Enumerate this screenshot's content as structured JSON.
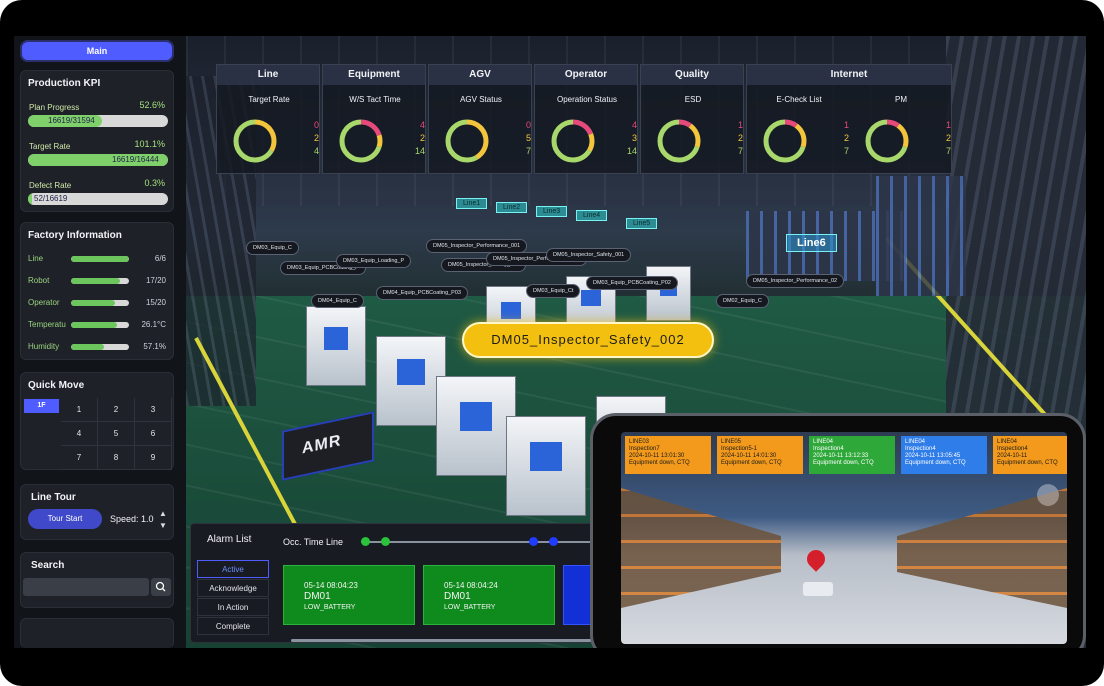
{
  "sidebar": {
    "main_label": "Main",
    "production_kpi": {
      "title": "Production KPI",
      "items": [
        {
          "label": "Plan Progress",
          "pct": "52.6%",
          "value": "16619/31594",
          "fraction": 0.526
        },
        {
          "label": "Target Rate",
          "pct": "101.1%",
          "value": "16619/16444",
          "fraction": 1.0
        },
        {
          "label": "Defect Rate",
          "pct": "0.3%",
          "value": "52/16619",
          "fraction": 0.03
        }
      ]
    },
    "factory_info": {
      "title": "Factory Information",
      "items": [
        {
          "label": "Line",
          "value": "6/6",
          "fraction": 1.0
        },
        {
          "label": "Robot",
          "value": "17/20",
          "fraction": 0.85
        },
        {
          "label": "Operator",
          "value": "15/20",
          "fraction": 0.75
        },
        {
          "label": "Temperatu",
          "value": "26.1°C",
          "fraction": 0.8
        },
        {
          "label": "Humidity",
          "value": "57.1%",
          "fraction": 0.57
        }
      ]
    },
    "quick_move": {
      "title": "Quick Move",
      "floor": "1F",
      "cells": [
        "1",
        "2",
        "3",
        "4",
        "5",
        "6",
        "7",
        "8",
        "9"
      ]
    },
    "line_tour": {
      "title": "Line Tour",
      "start_label": "Tour Start",
      "speed_label": "Speed: 1.0",
      "up": "▲",
      "down": "▼"
    },
    "search": {
      "title": "Search",
      "placeholder": "",
      "icon": "search-icon"
    }
  },
  "kpi_groups": [
    {
      "title": "Line",
      "cards": [
        {
          "title": "Target Rate",
          "counts": [
            "0",
            "2",
            "4"
          ],
          "split": [
            0,
            2,
            4
          ]
        }
      ]
    },
    {
      "title": "Equipment",
      "cards": [
        {
          "title": "W/S Tact Time",
          "counts": [
            "4",
            "2",
            "14"
          ],
          "split": [
            4,
            2,
            14
          ]
        }
      ]
    },
    {
      "title": "AGV",
      "cards": [
        {
          "title": "AGV Status",
          "counts": [
            "0",
            "5",
            "7"
          ],
          "split": [
            0,
            5,
            7
          ]
        }
      ]
    },
    {
      "title": "Operator",
      "cards": [
        {
          "title": "Operation Status",
          "counts": [
            "4",
            "3",
            "14"
          ],
          "split": [
            4,
            3,
            14
          ]
        }
      ]
    },
    {
      "title": "Quality",
      "cards": [
        {
          "title": "ESD",
          "counts": [
            "1",
            "2",
            "7"
          ],
          "split": [
            1,
            2,
            7
          ]
        }
      ]
    },
    {
      "title": "Internet",
      "cards": [
        {
          "title": "E-Check List",
          "counts": [
            "1",
            "2",
            "7"
          ],
          "split": [
            1,
            2,
            7
          ]
        },
        {
          "title": "PM",
          "counts": [
            "1",
            "2",
            "7"
          ],
          "split": [
            1,
            2,
            7
          ]
        }
      ]
    }
  ],
  "scene": {
    "highlight_label": "DM05_Inspector_Safety_002",
    "amr_label": "AMR",
    "line_tags": [
      "Line1",
      "Line2",
      "Line3",
      "Line4",
      "Line5",
      "Line6"
    ],
    "equipment_tags": [
      "DM03_Equip_C",
      "DM03_Equip_PCBCoating_P",
      "DM03_Equip_Loading_P",
      "DM04_Equip_C",
      "DM04_Equip_PCBCoating_P03",
      "DM05_Inspector_Safety_003",
      "DM05_Inspector_Performance_002",
      "DM05_Inspector_Performance_001",
      "DM05_Inspector_Safety_001",
      "DM03_Equip_PCBCoating_P02",
      "DM02_Equip_C",
      "DM05_Inspector_Performance_02",
      "DM03_Equip_Ct"
    ]
  },
  "alarm_list": {
    "title": "Alarm List",
    "tabs": [
      "Active",
      "Acknowledge",
      "In Action",
      "Complete"
    ],
    "active_tab": "Active",
    "timeline_label": "Occ. Time Line",
    "alarms": [
      {
        "time": "05-14 08:04:23",
        "device": "DM01",
        "message": "LOW_BATTERY"
      },
      {
        "time": "05-14 08:04:24",
        "device": "DM01",
        "message": "LOW_BATTERY"
      }
    ]
  },
  "phone": {
    "notifications": [
      {
        "line": "LINE03",
        "detail": "Inspection7",
        "time": "2024-10-11 13:01:30",
        "msg": "Equipment down, CTQ",
        "color": "orange"
      },
      {
        "line": "LINE05",
        "detail": "Inspection5-1",
        "time": "2024-10-11 14:01:30",
        "msg": "Equipment down, CTQ",
        "color": "orange"
      },
      {
        "line": "LINE04",
        "detail": "Inspection4",
        "time": "2024-10-11 13:12:33",
        "msg": "Equipment down, CTQ",
        "color": "green"
      },
      {
        "line": "LINE04",
        "detail": "Inspection4",
        "time": "2024-10-11 13:05:45",
        "msg": "Equipment down, CTQ",
        "color": "blue"
      },
      {
        "line": "LINE04",
        "detail": "Inspection4",
        "time": "2024-10-11",
        "msg": "Equipment down, CTQ",
        "color": "orange"
      }
    ]
  },
  "colors": {
    "accent": "#4f5cff",
    "red": "#e64a7c",
    "yellow": "#f2c53d",
    "green": "#a8d86b",
    "highlight": "#f3c00f",
    "alarm_green": "#0f8a1c"
  }
}
